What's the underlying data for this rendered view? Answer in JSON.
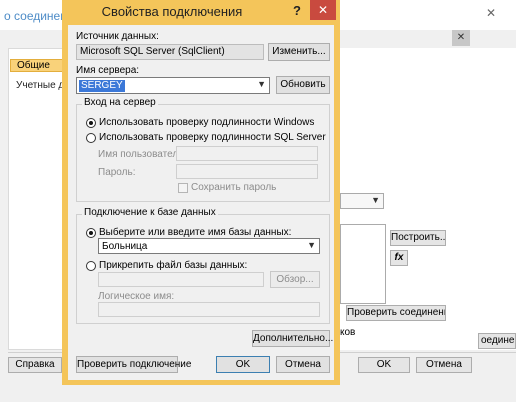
{
  "background": {
    "window_title": "о соединени",
    "close_glyph": "✕",
    "inner_close_glyph": "✕",
    "nav_general": "Общие",
    "nav_accounts": "Учетные дан",
    "build_button": "Построить...",
    "function_button": "fx",
    "test_connection_button": "Проверить соединение",
    "partial_label": "ков",
    "ok_button": "OK",
    "cancel_button": "Отмена",
    "help_button": "Справка",
    "right_edge_button": "оединение"
  },
  "dialog": {
    "title": "Свойства подключения",
    "help_glyph": "?",
    "close_glyph": "✕",
    "data_source_label": "Источник данных:",
    "data_source_value": "Microsoft SQL Server (SqlClient)",
    "change_button": "Изменить...",
    "server_name_label": "Имя сервера:",
    "server_name_value": "SERGEY",
    "refresh_button": "Обновить",
    "logon_group_title": "Вход на сервер",
    "auth_windows": "Использовать проверку подлинности Windows",
    "auth_sql": "Использовать проверку подлинности SQL Server",
    "username_label": "Имя пользователя:",
    "password_label": "Пароль:",
    "save_password_label": "Сохранить пароль",
    "db_group_title": "Подключение к базе данных",
    "select_db_option": "Выберите или введите имя базы данных:",
    "db_name_value": "Больница",
    "attach_db_option": "Прикрепить файл базы данных:",
    "browse_button": "Обзор...",
    "logical_name_label": "Логическое имя:",
    "advanced_button": "Дополнительно...",
    "test_connection_button": "Проверить подключение",
    "ok_button": "OK",
    "cancel_button": "Отмена",
    "auth_mode_selected": "windows",
    "db_mode_selected": "select"
  },
  "colors": {
    "dialog_frame": "#f4c55a",
    "close_button": "#c94a3f",
    "selection": "#3b78d8"
  }
}
